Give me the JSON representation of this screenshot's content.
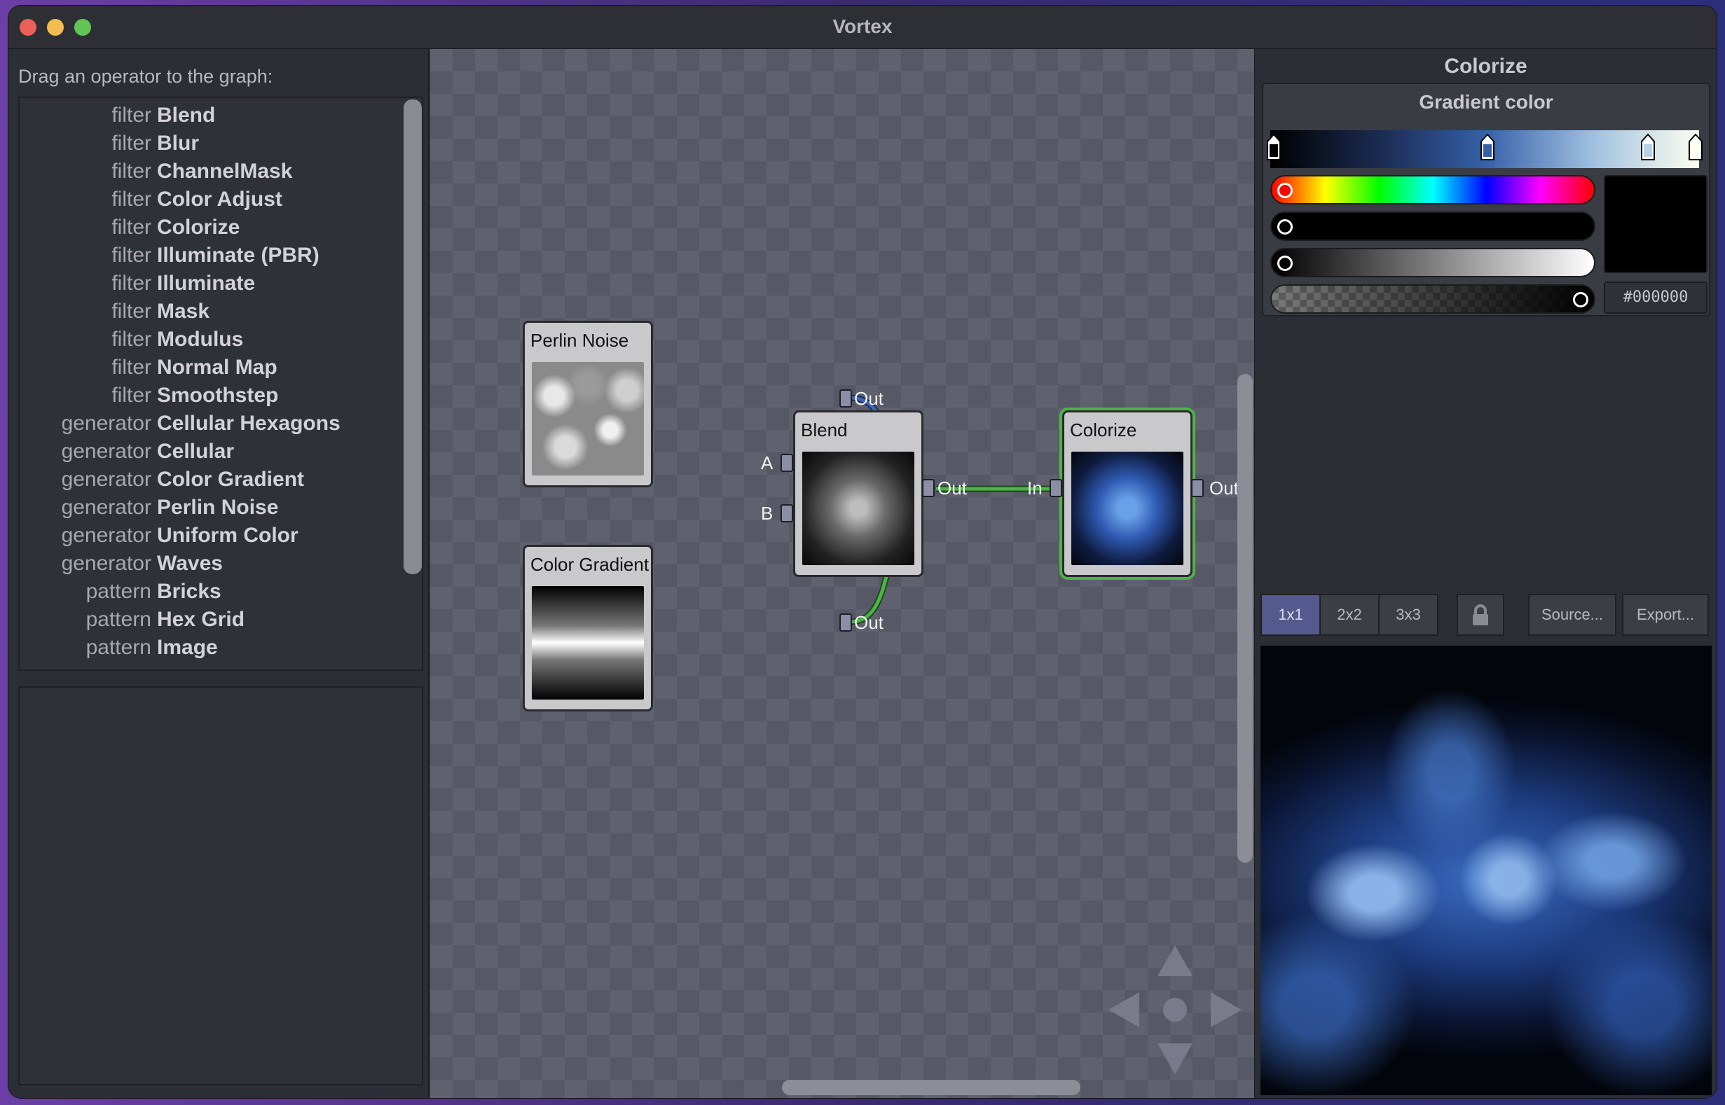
{
  "window": {
    "title": "Vortex"
  },
  "left": {
    "hint": "Drag an operator to the graph:",
    "operators": [
      {
        "category": "filter",
        "name": "Blend"
      },
      {
        "category": "filter",
        "name": "Blur"
      },
      {
        "category": "filter",
        "name": "ChannelMask"
      },
      {
        "category": "filter",
        "name": "Color Adjust"
      },
      {
        "category": "filter",
        "name": "Colorize"
      },
      {
        "category": "filter",
        "name": "Illuminate (PBR)"
      },
      {
        "category": "filter",
        "name": "Illuminate"
      },
      {
        "category": "filter",
        "name": "Mask"
      },
      {
        "category": "filter",
        "name": "Modulus"
      },
      {
        "category": "filter",
        "name": "Normal Map"
      },
      {
        "category": "filter",
        "name": "Smoothstep"
      },
      {
        "category": "generator",
        "name": "Cellular Hexagons"
      },
      {
        "category": "generator",
        "name": "Cellular"
      },
      {
        "category": "generator",
        "name": "Color Gradient"
      },
      {
        "category": "generator",
        "name": "Perlin Noise"
      },
      {
        "category": "generator",
        "name": "Uniform Color"
      },
      {
        "category": "generator",
        "name": "Waves"
      },
      {
        "category": "pattern",
        "name": "Bricks"
      },
      {
        "category": "pattern",
        "name": "Hex Grid"
      },
      {
        "category": "pattern",
        "name": "Image"
      }
    ]
  },
  "graph": {
    "nodes": {
      "perlin": {
        "title": "Perlin Noise",
        "out": "Out"
      },
      "gradient": {
        "title": "Color Gradient",
        "out": "Out"
      },
      "blend": {
        "title": "Blend",
        "in_a": "A",
        "in_b": "B",
        "out": "Out"
      },
      "colorize": {
        "title": "Colorize",
        "in": "In",
        "out": "Out"
      }
    }
  },
  "right": {
    "title": "Colorize",
    "gradient_label": "Gradient color",
    "hex_value": "#000000",
    "tiling_buttons": [
      "1x1",
      "2x2",
      "3x3"
    ],
    "selected_tiling": "1x1",
    "source_button": "Source...",
    "export_button": "Export..."
  },
  "colors": {
    "selection_green": "#4fb24a",
    "wire_blue": "#3d66b8",
    "wire_green": "#4fb24a",
    "accent_purple": "#5a5f9a"
  }
}
